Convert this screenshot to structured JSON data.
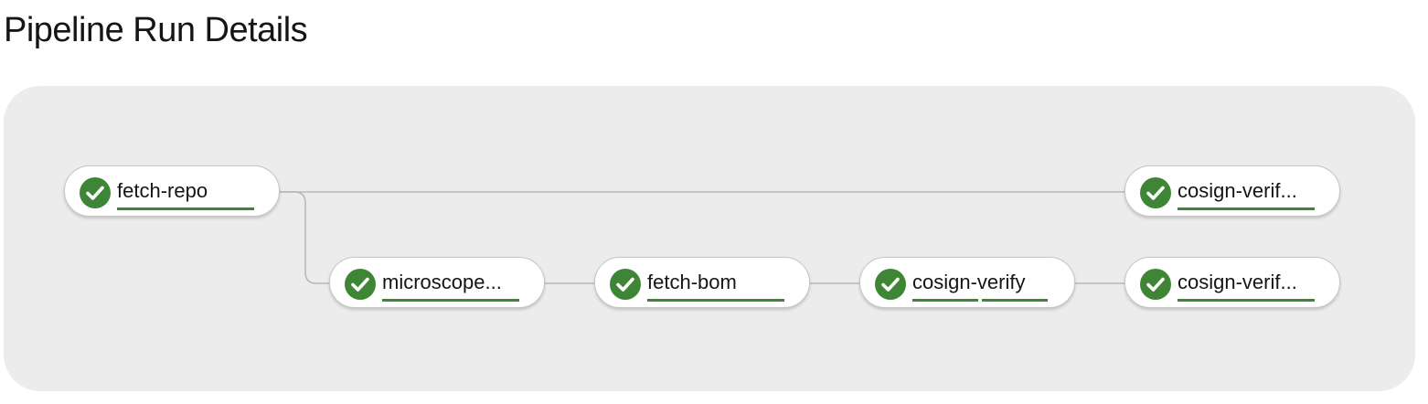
{
  "page": {
    "title": "Pipeline Run Details"
  },
  "pipeline": {
    "status_color": "#3e8635",
    "tasks": [
      {
        "id": "fetch-repo",
        "label": "fetch-repo",
        "status": "succeeded",
        "status_icon": "check-circle-icon",
        "progress_segments": 1
      },
      {
        "id": "cosign-verify-top",
        "label": "cosign-verif...",
        "status": "succeeded",
        "status_icon": "check-circle-icon",
        "progress_segments": 1
      },
      {
        "id": "microscope",
        "label": "microscope...",
        "status": "succeeded",
        "status_icon": "check-circle-icon",
        "progress_segments": 1
      },
      {
        "id": "fetch-bom",
        "label": "fetch-bom",
        "status": "succeeded",
        "status_icon": "check-circle-icon",
        "progress_segments": 1
      },
      {
        "id": "cosign-verify",
        "label": "cosign-verify",
        "status": "succeeded",
        "status_icon": "check-circle-icon",
        "progress_segments": 2
      },
      {
        "id": "cosign-verify-bottom",
        "label": "cosign-verif...",
        "status": "succeeded",
        "status_icon": "check-circle-icon",
        "progress_segments": 1
      }
    ]
  }
}
